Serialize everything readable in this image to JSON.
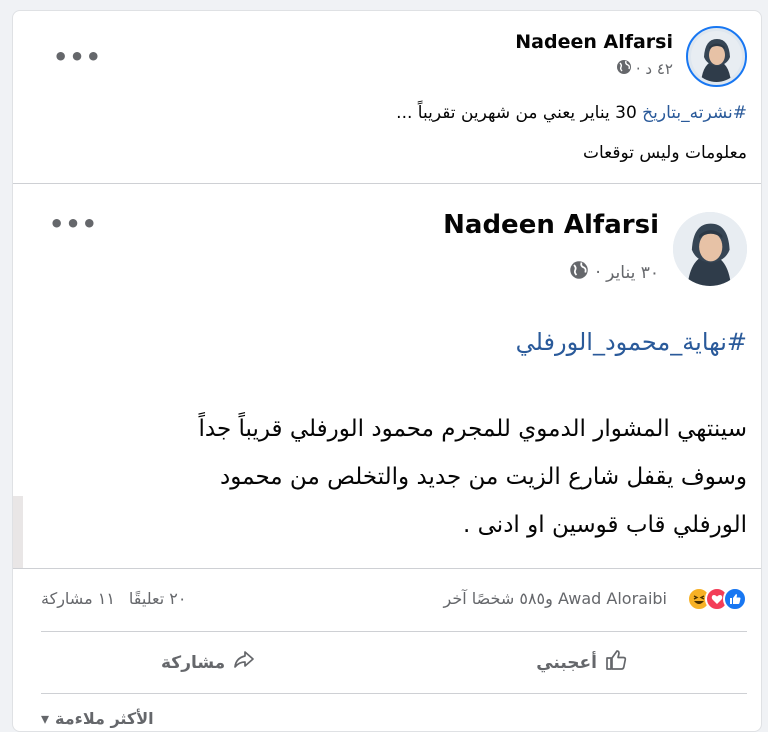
{
  "outer_post": {
    "author": "Nadeen Alfarsi",
    "time": "٤٢ د ·",
    "hashtag": "#نشرته_بتاريخ",
    "line1_rest": " 30 يناير يعني من شهرين تقريباً ...",
    "line2": "معلومات وليس توقعات",
    "more_icon": "more-dots-icon",
    "privacy_icon": "globe-icon"
  },
  "shared_post": {
    "author": "Nadeen Alfarsi",
    "time": "٣٠ يناير ·",
    "hashtag": "#نهاية_محمود_الورفلي",
    "body": [
      "سينتهي المشوار الدموي للمجرم محمود الورفلي قريباً جداً",
      "وسوف يقفل شارع الزيت من جديد والتخلص من محمود",
      "الورفلي قاب قوسين او ادنى ."
    ],
    "more_icon": "more-dots-icon",
    "privacy_icon": "globe-icon"
  },
  "stats": {
    "reactions_text": "Awad Aloraibi و٥٨٥ شخصًا آخر",
    "comments": "٢٠ تعليقًا",
    "shares": "١١ مشاركة",
    "reaction_icons": [
      "like-icon",
      "love-icon",
      "haha-icon"
    ],
    "reaction_colors": {
      "like": "#1877f2",
      "love": "#f33e58",
      "haha": "#f7b125"
    }
  },
  "actions": {
    "like_label": "أعجبني",
    "share_label": "مشاركة"
  },
  "comments_filter": {
    "label": "الأكثر ملاءمة"
  }
}
